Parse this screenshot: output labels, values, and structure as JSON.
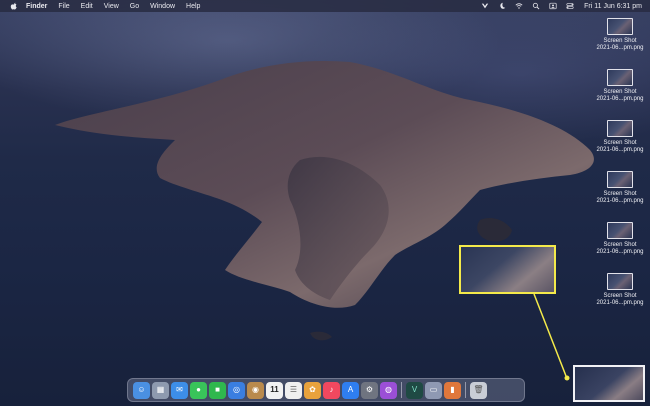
{
  "menubar": {
    "app_name": "Finder",
    "menus": [
      "File",
      "Edit",
      "View",
      "Go",
      "Window",
      "Help"
    ],
    "clock": "Fri 11 Jun  6:31 pm",
    "status_icons": [
      "vpn-shield-icon",
      "moon-icon",
      "wifi-icon",
      "search-icon",
      "user-switch-icon",
      "control-center-icon"
    ]
  },
  "desktop": {
    "files": [
      {
        "line1": "Screen Shot",
        "line2": "2021-06...pm.png"
      },
      {
        "line1": "Screen Shot",
        "line2": "2021-06...pm.png"
      },
      {
        "line1": "Screen Shot",
        "line2": "2021-06...pm.png"
      },
      {
        "line1": "Screen Shot",
        "line2": "2021-06...pm.png"
      },
      {
        "line1": "Screen Shot",
        "line2": "2021-06...pm.png"
      },
      {
        "line1": "Screen Shot",
        "line2": "2021-06...pm.png"
      }
    ]
  },
  "highlight": {
    "color": "#f4ea4a"
  },
  "dock": {
    "calendar_day": "11",
    "apps": [
      {
        "name": "finder-icon",
        "color": "#4a90e2"
      },
      {
        "name": "launchpad-icon",
        "color": "#8e9aaf"
      },
      {
        "name": "mail-icon",
        "color": "#3d8ee8"
      },
      {
        "name": "messages-icon",
        "color": "#39c45a"
      },
      {
        "name": "facetime-icon",
        "color": "#2fb84e"
      },
      {
        "name": "safari-icon",
        "color": "#3a7ee0"
      },
      {
        "name": "contacts-icon",
        "color": "#b98a4d"
      },
      {
        "name": "calendar-icon",
        "color": "#f2f2f2"
      },
      {
        "name": "reminders-icon",
        "color": "#efefef"
      },
      {
        "name": "photos-icon",
        "color": "#e8a23c"
      },
      {
        "name": "music-icon",
        "color": "#f2485f"
      },
      {
        "name": "app-store-icon",
        "color": "#2f7ef0"
      },
      {
        "name": "system-preferences-icon",
        "color": "#6f7480"
      },
      {
        "name": "podcasts-icon",
        "color": "#9b4fd6"
      },
      {
        "name": "vpn-app-icon",
        "color": "#1f4a44"
      },
      {
        "name": "screenshot-app-icon",
        "color": "#8f99b3"
      },
      {
        "name": "books-icon",
        "color": "#e0773b"
      },
      {
        "name": "trash-icon",
        "color": "#c9cdd6"
      }
    ]
  }
}
